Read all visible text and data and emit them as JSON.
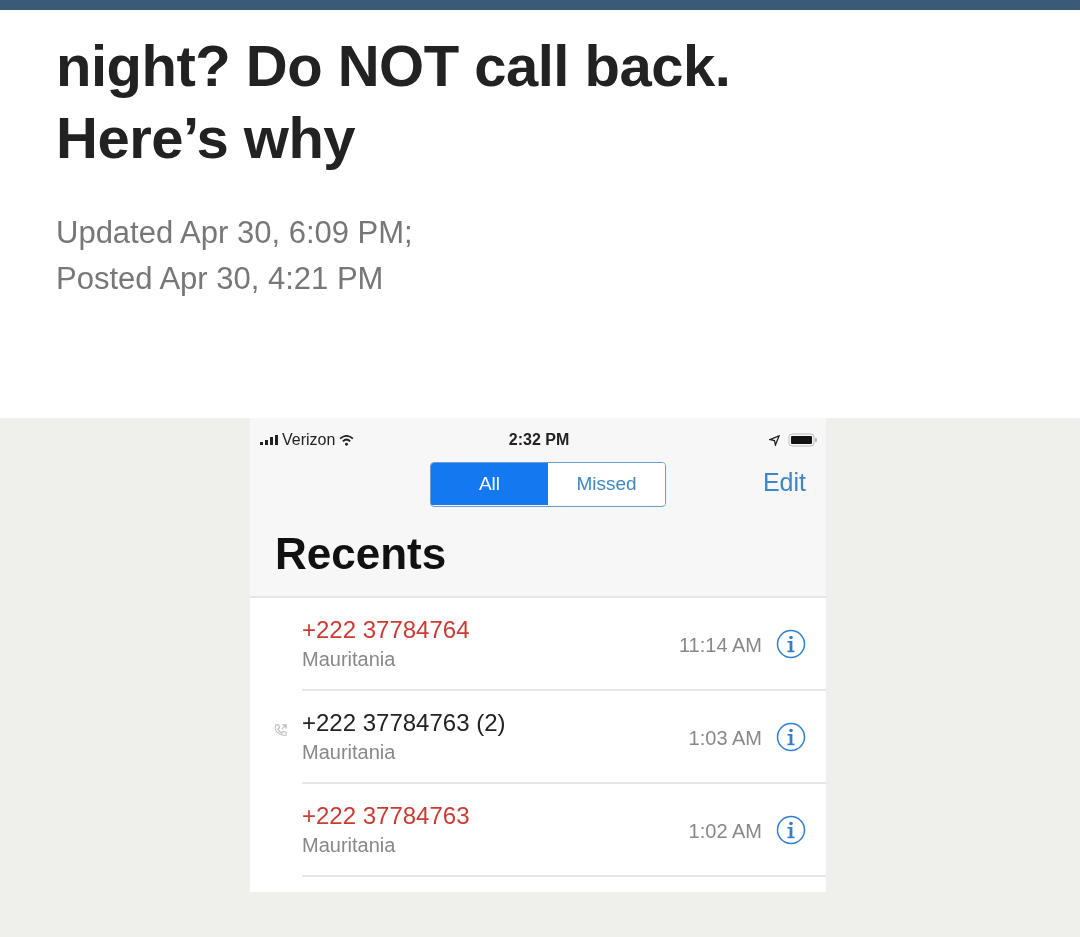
{
  "article": {
    "headline": "night? Do NOT call back. Here’s why",
    "updated": "Updated Apr 30, 6:09 PM;",
    "posted": "Posted Apr 30, 4:21 PM"
  },
  "phone": {
    "status_bar": {
      "carrier": "Verizon",
      "time": "2:32 PM"
    },
    "segments": [
      {
        "label": "All",
        "selected": true
      },
      {
        "label": "Missed",
        "selected": false
      }
    ],
    "edit": "Edit",
    "title": "Recents",
    "calls": [
      {
        "kind": "missed",
        "number": "+222 37784764",
        "place": "Mauritania",
        "time": "11:14 AM"
      },
      {
        "kind": "outgoing",
        "number": "+222 37784763 (2)",
        "place": "Mauritania",
        "time": "1:03 AM"
      },
      {
        "kind": "missed",
        "number": "+222 37784763",
        "place": "Mauritania",
        "time": "1:02 AM"
      }
    ]
  }
}
